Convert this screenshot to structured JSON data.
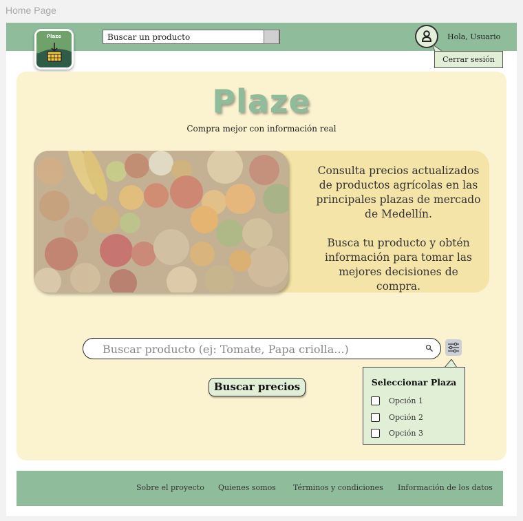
{
  "frame_label": "Home Page",
  "header": {
    "logo_text": "Plaze",
    "search_value": "Buscar un producto",
    "greeting": "Hola, Usuario",
    "logout_label": "Cerrar sesión"
  },
  "hero": {
    "brand": "Plaze",
    "tagline": "Compra mejor con información real",
    "info_paragraph_1": "Consulta precios actualizados de productos agrícolas en las principales plazas de mercado de Medellín.",
    "info_paragraph_2": "Busca tu producto y obtén información para tomar las mejores decisiones de compra."
  },
  "search": {
    "placeholder": "Buscar producto (ej: Tomate, Papa criolla...)",
    "button_label": "Buscar precios"
  },
  "plaza_filter": {
    "title": "Seleccionar Plaza",
    "options": [
      "Opción 1",
      "Opción 2",
      "Opción 3"
    ]
  },
  "footer": {
    "links": [
      "Sobre el proyecto",
      "Quienes somos",
      "Términos y condiciones",
      "Información de los datos"
    ]
  },
  "colors": {
    "header_green": "#8fbd9c",
    "hero_cream": "#fbf3cf",
    "panel_yellow": "#f5e4a8",
    "button_mint": "#e2efd7"
  }
}
